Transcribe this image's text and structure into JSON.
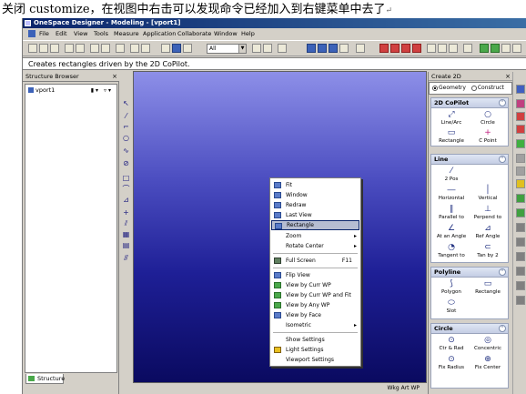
{
  "caption": {
    "text": "关闭 customize，在视图中右击可以发现命令已经加入到右键菜单中去了",
    "mark": "↵"
  },
  "window": {
    "title": "OneSpace Designer - Modeling - [vport1]"
  },
  "menubar": {
    "items": [
      "File",
      "Edit",
      "View",
      "Tools",
      "Measure",
      "Application",
      "Collaborate",
      "Window",
      "Help"
    ]
  },
  "toolbar": {
    "filter_value": "All"
  },
  "status_line": "Creates rectangles driven by the 2D CoPilot.",
  "structure_browser": {
    "title": "Structure Browser",
    "close": "×",
    "root_item": "vport1",
    "tab_label": "Structure"
  },
  "context_menu": {
    "items": [
      {
        "label": "Fit",
        "icon": "fit-icon"
      },
      {
        "label": "Window",
        "icon": "window-zoom-icon"
      },
      {
        "label": "Redraw",
        "icon": "redraw-icon"
      },
      {
        "label": "Last View",
        "icon": "last-view-icon"
      },
      {
        "label": "Rectangle",
        "icon": "rectangle-icon",
        "selected": true
      },
      {
        "label": "Zoom",
        "submenu": true
      },
      {
        "label": "Rotate Center",
        "submenu": true
      },
      {
        "label": "Full Screen",
        "shortcut": "F11",
        "icon": "full-screen-icon"
      },
      {
        "label": "Flip View",
        "icon": "flip-view-icon"
      },
      {
        "label": "View by Curr WP",
        "icon": "view-wp-icon"
      },
      {
        "label": "View by Curr WP and Fit",
        "icon": "view-wp-fit-icon"
      },
      {
        "label": "View by Any WP",
        "icon": "view-any-wp-icon"
      },
      {
        "label": "View by Face",
        "icon": "view-face-icon"
      },
      {
        "label": "Isometric",
        "submenu": true
      },
      {
        "label": "Show Settings"
      },
      {
        "label": "Light Settings",
        "icon": "light-icon"
      },
      {
        "label": "Viewport Settings"
      }
    ]
  },
  "create2d": {
    "title": "Create 2D",
    "close": "×",
    "radio_geometry": "Geometry",
    "radio_construct": "Construct",
    "sections": {
      "copilot": {
        "title": "2D CoPilot",
        "tools": [
          "Line/Arc",
          "Circle",
          "Rectangle",
          "C Point"
        ]
      },
      "line": {
        "title": "Line",
        "tools": [
          "2 Pos",
          "Horizontal",
          "Vertical",
          "Parallel to",
          "Perpend to",
          "At an Angle",
          "Ref Angle",
          "Tangent to",
          "Tan by 2"
        ]
      },
      "polyline": {
        "title": "Polyline",
        "tools": [
          "Polygon",
          "Rectangle",
          "Slot"
        ]
      },
      "circle": {
        "title": "Circle",
        "tools": [
          "Ctr & Rad",
          "Concentric",
          "Fix Radius",
          "Fix Center"
        ]
      }
    }
  },
  "viewport_status": "Wkg Art WP"
}
